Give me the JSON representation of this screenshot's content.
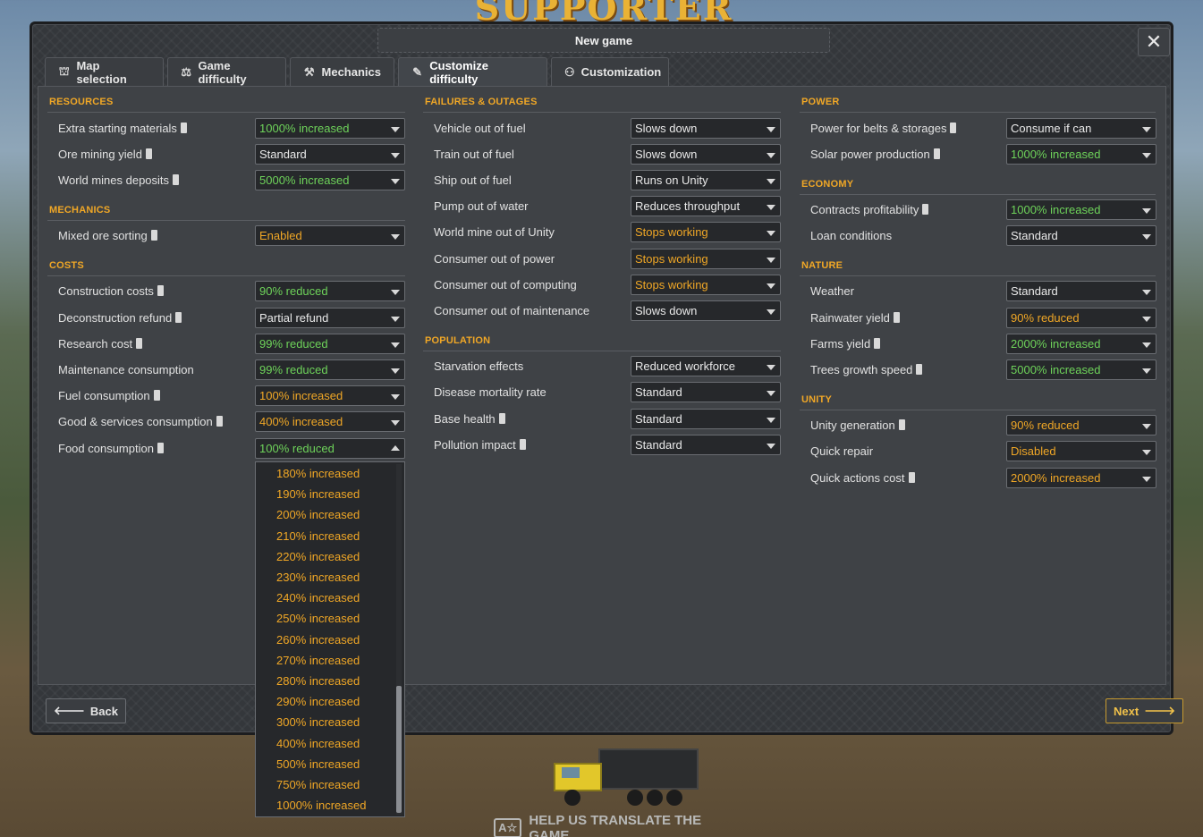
{
  "background": {
    "banner_text": "SUPPORTER EDITION",
    "translate_text": "HELP US TRANSLATE THE GAME",
    "translate_icon": "A☆"
  },
  "window": {
    "title": "New game",
    "close_icon": "✕"
  },
  "tabs": [
    {
      "label": "Map selection",
      "icon": "map-person-icon",
      "glyph": "⛫"
    },
    {
      "label": "Game difficulty",
      "icon": "scales-icon",
      "glyph": "⚖"
    },
    {
      "label": "Mechanics",
      "icon": "hammer-icon",
      "glyph": "⚒"
    },
    {
      "label": "Customize difficulty",
      "icon": "wrench-icon",
      "glyph": "✎",
      "active": true
    },
    {
      "label": "Customization",
      "icon": "people-icon",
      "glyph": "⚇"
    }
  ],
  "columns": {
    "left": {
      "resources": {
        "heading": "RESOURCES",
        "rows": [
          {
            "label": "Extra starting materials",
            "info": true,
            "value": "1000% increased",
            "color": "green"
          },
          {
            "label": "Ore mining yield",
            "info": true,
            "value": "Standard",
            "color": "white"
          },
          {
            "label": "World mines deposits",
            "info": true,
            "value": "5000% increased",
            "color": "green"
          }
        ]
      },
      "mechanics": {
        "heading": "MECHANICS",
        "rows": [
          {
            "label": "Mixed ore sorting",
            "info": true,
            "value": "Enabled",
            "color": "orange"
          }
        ]
      },
      "costs": {
        "heading": "COSTS",
        "rows": [
          {
            "label": "Construction costs",
            "info": true,
            "value": "90% reduced",
            "color": "green"
          },
          {
            "label": "Deconstruction refund",
            "info": true,
            "value": "Partial refund",
            "color": "white"
          },
          {
            "label": "Research cost",
            "info": true,
            "value": "99% reduced",
            "color": "green"
          },
          {
            "label": "Maintenance consumption",
            "info": false,
            "value": "99% reduced",
            "color": "green"
          },
          {
            "label": "Fuel consumption",
            "info": true,
            "value": "100% increased",
            "color": "orange"
          },
          {
            "label": "Good & services consumption",
            "info": true,
            "value": "400% increased",
            "color": "orange"
          },
          {
            "label": "Food consumption",
            "info": true,
            "value": "100% reduced",
            "color": "green"
          }
        ]
      }
    },
    "middle": {
      "failures": {
        "heading": "FAILURES & OUTAGES",
        "rows": [
          {
            "label": "Vehicle out of fuel",
            "value": "Slows down",
            "color": "white"
          },
          {
            "label": "Train out of fuel",
            "value": "Slows down",
            "color": "white"
          },
          {
            "label": "Ship out of fuel",
            "value": "Runs on Unity",
            "color": "white"
          },
          {
            "label": "Pump out of water",
            "value": "Reduces throughput",
            "color": "white"
          },
          {
            "label": "World mine out of Unity",
            "value": "Stops working",
            "color": "orange"
          },
          {
            "label": "Consumer out of power",
            "value": "Stops working",
            "color": "orange"
          },
          {
            "label": "Consumer out of computing",
            "value": "Stops working",
            "color": "orange"
          },
          {
            "label": "Consumer out of maintenance",
            "value": "Slows down",
            "color": "white"
          }
        ]
      },
      "population": {
        "heading": "POPULATION",
        "rows": [
          {
            "label": "Starvation effects",
            "info": false,
            "value": "Reduced workforce",
            "color": "white"
          },
          {
            "label": "Disease mortality rate",
            "info": false,
            "value": "Standard",
            "color": "white"
          },
          {
            "label": "Base health",
            "info": true,
            "value": "Standard",
            "color": "white"
          },
          {
            "label": "Pollution impact",
            "info": true,
            "value": "Standard",
            "color": "white"
          }
        ]
      }
    },
    "right": {
      "power": {
        "heading": "POWER",
        "rows": [
          {
            "label": "Power for belts & storages",
            "info": true,
            "value": "Consume if can",
            "color": "white"
          },
          {
            "label": "Solar power production",
            "info": true,
            "value": "1000% increased",
            "color": "green"
          }
        ]
      },
      "economy": {
        "heading": "ECONOMY",
        "rows": [
          {
            "label": "Contracts profitability",
            "info": true,
            "value": "1000% increased",
            "color": "green"
          },
          {
            "label": "Loan conditions",
            "info": false,
            "value": "Standard",
            "color": "white"
          }
        ]
      },
      "nature": {
        "heading": "NATURE",
        "rows": [
          {
            "label": "Weather",
            "info": false,
            "value": "Standard",
            "color": "white"
          },
          {
            "label": "Rainwater yield",
            "info": true,
            "value": "90% reduced",
            "color": "orange"
          },
          {
            "label": "Farms yield",
            "info": true,
            "value": "2000% increased",
            "color": "green"
          },
          {
            "label": "Trees growth speed",
            "info": true,
            "value": "5000% increased",
            "color": "green"
          }
        ]
      },
      "unity": {
        "heading": "UNITY",
        "rows": [
          {
            "label": "Unity generation",
            "info": true,
            "value": "90% reduced",
            "color": "orange"
          },
          {
            "label": "Quick repair",
            "info": false,
            "value": "Disabled",
            "color": "orange"
          },
          {
            "label": "Quick actions cost",
            "info": true,
            "value": "2000% increased",
            "color": "orange"
          }
        ]
      }
    }
  },
  "open_dropdown": {
    "options": [
      "180% increased",
      "190% increased",
      "200% increased",
      "210% increased",
      "220% increased",
      "230% increased",
      "240% increased",
      "250% increased",
      "260% increased",
      "270% increased",
      "280% increased",
      "290% increased",
      "300% increased",
      "400% increased",
      "500% increased",
      "750% increased",
      "1000% increased"
    ]
  },
  "footer": {
    "back_label": "Back",
    "next_label": "Next",
    "back_icon": "arrow-left-icon",
    "next_icon": "arrow-right-icon"
  },
  "colors": {
    "accent_orange": "#f0a726",
    "green": "#6ed35a",
    "panel": "#3f4246"
  }
}
